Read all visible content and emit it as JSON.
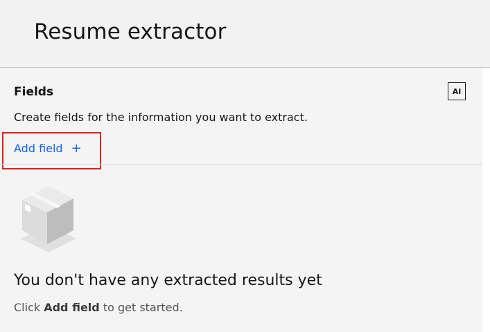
{
  "header": {
    "title": "Resume extractor"
  },
  "fields": {
    "heading": "Fields",
    "ai_badge": "AI",
    "description": "Create fields for the information you want to extract.",
    "add_field_label": "Add field",
    "add_icon": "plus-icon"
  },
  "empty_state": {
    "illustration_icon": "box-icon",
    "title": "You don't have any extracted results yet",
    "sub_prefix": "Click",
    "sub_bold": "Add field",
    "sub_suffix": "to get started."
  },
  "colors": {
    "link": "#0f62fe",
    "highlight": "#e02020",
    "background": "#f4f4f4"
  }
}
